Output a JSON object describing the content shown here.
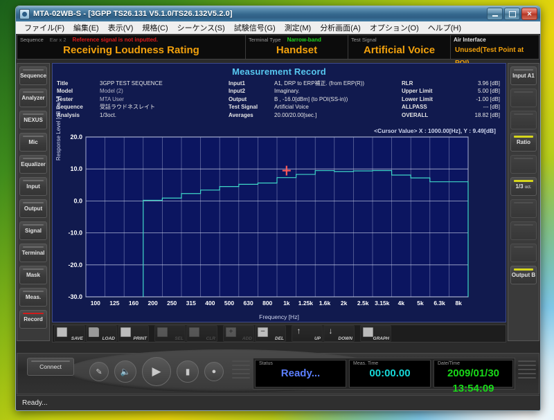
{
  "window": {
    "title": "MTA-02WB-S - [3GPP TS26.131 V5.1.0/TS26.132V5.2.0]",
    "app_icon": "app-disc-icon",
    "minimize": "minimize-icon",
    "maximize": "maximize-icon",
    "close": "close-icon"
  },
  "menubar": {
    "items": [
      {
        "label": "ファイル(F)"
      },
      {
        "label": "編集(E)"
      },
      {
        "label": "表示(V)"
      },
      {
        "label": "規格(C)"
      },
      {
        "label": "シーケンス(S)"
      },
      {
        "label": "試験信号(G)"
      },
      {
        "label": "測定(M)"
      },
      {
        "label": "分析画面(A)"
      },
      {
        "label": "オプション(O)"
      },
      {
        "label": "ヘルプ(H)"
      }
    ]
  },
  "infostrip": {
    "sequence": {
      "label": "Sequence",
      "sub": "Ear x 2",
      "warning": "Reference signal is not inputted.",
      "value": "Receiving Loudness Rating"
    },
    "terminal": {
      "label": "Terminal Type",
      "mode": "Narrow-band",
      "value": "Handset"
    },
    "test_signal": {
      "label": "Test Signal",
      "value": "Artificial Voice"
    },
    "air_interface": {
      "label": "Air Interface",
      "value": "Unused(Test Point at POI)"
    }
  },
  "left_sidebar": {
    "items": [
      {
        "label": "Sequence",
        "state": "normal"
      },
      {
        "label": "Analyzer",
        "state": "normal"
      },
      {
        "label": "NEXUS",
        "state": "normal"
      },
      {
        "label": "Mic",
        "state": "normal"
      },
      {
        "label": "Equalizer",
        "state": "normal"
      },
      {
        "label": "Input",
        "state": "normal"
      },
      {
        "label": "Output",
        "state": "normal"
      },
      {
        "label": "Signal",
        "state": "normal"
      },
      {
        "label": "Terminal",
        "state": "normal"
      },
      {
        "label": "Mask",
        "state": "normal"
      },
      {
        "label": "Meas.",
        "state": "normal"
      },
      {
        "label": "Record",
        "state": "active"
      }
    ]
  },
  "right_sidebar": {
    "items": [
      {
        "label": "Input A1",
        "state": "normal"
      },
      {
        "label": "",
        "state": "empty"
      },
      {
        "label": "",
        "state": "empty"
      },
      {
        "label": "Ratio",
        "state": "accent"
      },
      {
        "label": "",
        "state": "empty"
      },
      {
        "label": "1/3 oct.",
        "state": "accent"
      },
      {
        "label": "",
        "state": "empty"
      },
      {
        "label": "",
        "state": "empty"
      },
      {
        "label": "",
        "state": "empty"
      },
      {
        "label": "Output B",
        "state": "accent"
      }
    ]
  },
  "record": {
    "title": "Measurement Record",
    "col1": [
      {
        "key": "Title",
        "value": "3GPP TEST SEQUENCE",
        "dim": false
      },
      {
        "key": "Model",
        "value": "Model (2)",
        "dim": true
      },
      {
        "key": "Tester",
        "value": "MTA User",
        "dim": true
      },
      {
        "key": "Sequence",
        "value": "受話ラウドネスレイト",
        "dim": false
      },
      {
        "key": "Analysis",
        "value": "1/3oct.",
        "dim": false
      }
    ],
    "col2": [
      {
        "key": "Input1",
        "value": "A1, DRP to ERP補正. (from ERP(R))",
        "dim": false
      },
      {
        "key": "Input2",
        "value": "Imaginary.",
        "dim": false
      },
      {
        "key": "Output",
        "value": "B , -16.0[dBm] (to POI(SS-in))",
        "dim": false
      },
      {
        "key": "Test Signal",
        "value": "Artificial Voice",
        "dim": false
      },
      {
        "key": "Averages",
        "value": "20.00/20.00[sec.]",
        "dim": false
      }
    ],
    "col3": [
      {
        "key": "RLR",
        "value": "3.96 [dB]"
      },
      {
        "key": "Upper Limit",
        "value": "5.00 [dB]"
      },
      {
        "key": "Lower Limit",
        "value": "-1.00 [dB]"
      },
      {
        "key": "ALLPASS",
        "value": "--- [dB]"
      },
      {
        "key": "OVERALL",
        "value": "18.82 [dB]"
      }
    ],
    "cursor_value": "<Cursor Value> X : 1000.00[Hz],  Y : 9.49[dB]"
  },
  "chart_data": {
    "type": "line",
    "title": "Measurement Record",
    "xlabel": "Frequency [Hz]",
    "ylabel": "Response Level [dB Pa/V]",
    "ylim": [
      -30.0,
      20.0
    ],
    "yticks": [
      "20.0",
      "10.0",
      "0.0",
      "-10.0",
      "-20.0",
      "-30.0"
    ],
    "ytick_values": [
      20.0,
      10.0,
      0.0,
      -10.0,
      -20.0,
      -30.0
    ],
    "categories": [
      "100",
      "125",
      "160",
      "200",
      "250",
      "315",
      "400",
      "500",
      "630",
      "800",
      "1k",
      "1.25k",
      "1.6k",
      "2k",
      "2.5k",
      "3.15k",
      "4k",
      "5k",
      "6.3k",
      "8k"
    ],
    "series": [
      {
        "name": "Response",
        "color": "#3fd8c8",
        "values": [
          null,
          null,
          null,
          0.2,
          0.9,
          2.3,
          3.4,
          4.5,
          5.2,
          5.6,
          7.3,
          8.3,
          9.49,
          9.2,
          9.4,
          9.5,
          8.1,
          7.2,
          6.0,
          6.0
        ]
      }
    ],
    "grid": true,
    "legend": "none",
    "cursor": {
      "x": "1k",
      "y": 9.49,
      "color": "#ff5a5a",
      "marker": "cross"
    },
    "annotation": "<Cursor Value> X : 1000.00[Hz],  Y : 9.49[dB]"
  },
  "toolbar": {
    "buttons": [
      {
        "label": "SAVE",
        "icon": "floppy-icon",
        "enabled": true
      },
      {
        "label": "LOAD",
        "icon": "folder-icon",
        "enabled": true
      },
      {
        "label": "PRINT",
        "icon": "printer-icon",
        "enabled": true
      },
      {
        "label": "SEL",
        "icon": "select-icon",
        "enabled": false
      },
      {
        "label": "CLR",
        "icon": "clear-icon",
        "enabled": false
      },
      {
        "label": "ADD",
        "icon": "plus-icon",
        "enabled": false
      },
      {
        "label": "DEL",
        "icon": "minus-icon",
        "enabled": true
      },
      {
        "label": "UP",
        "icon": "arrow-up-icon",
        "enabled": true
      },
      {
        "label": "DOWN",
        "icon": "arrow-down-icon",
        "enabled": true
      },
      {
        "label": "GRAPH",
        "icon": "graph-icon",
        "enabled": true
      }
    ]
  },
  "transport": {
    "connect_label": "Connect",
    "buttons": [
      {
        "icon": "pen-icon",
        "glyph": "✎"
      },
      {
        "icon": "speaker-icon",
        "glyph": "🔈"
      },
      {
        "icon": "play-icon",
        "glyph": "▶"
      },
      {
        "icon": "stop-icon",
        "glyph": "▮"
      },
      {
        "icon": "record-icon",
        "glyph": "●"
      }
    ],
    "readouts": {
      "status_label": "Status",
      "status_value": "Ready...",
      "meas_label": "Meas. Time",
      "meas_value": "00:00.00",
      "datetime_label": "Date/Time",
      "datetime_value": "2009/01/30 13:54:09"
    }
  },
  "statusbar": {
    "text": "Ready..."
  }
}
